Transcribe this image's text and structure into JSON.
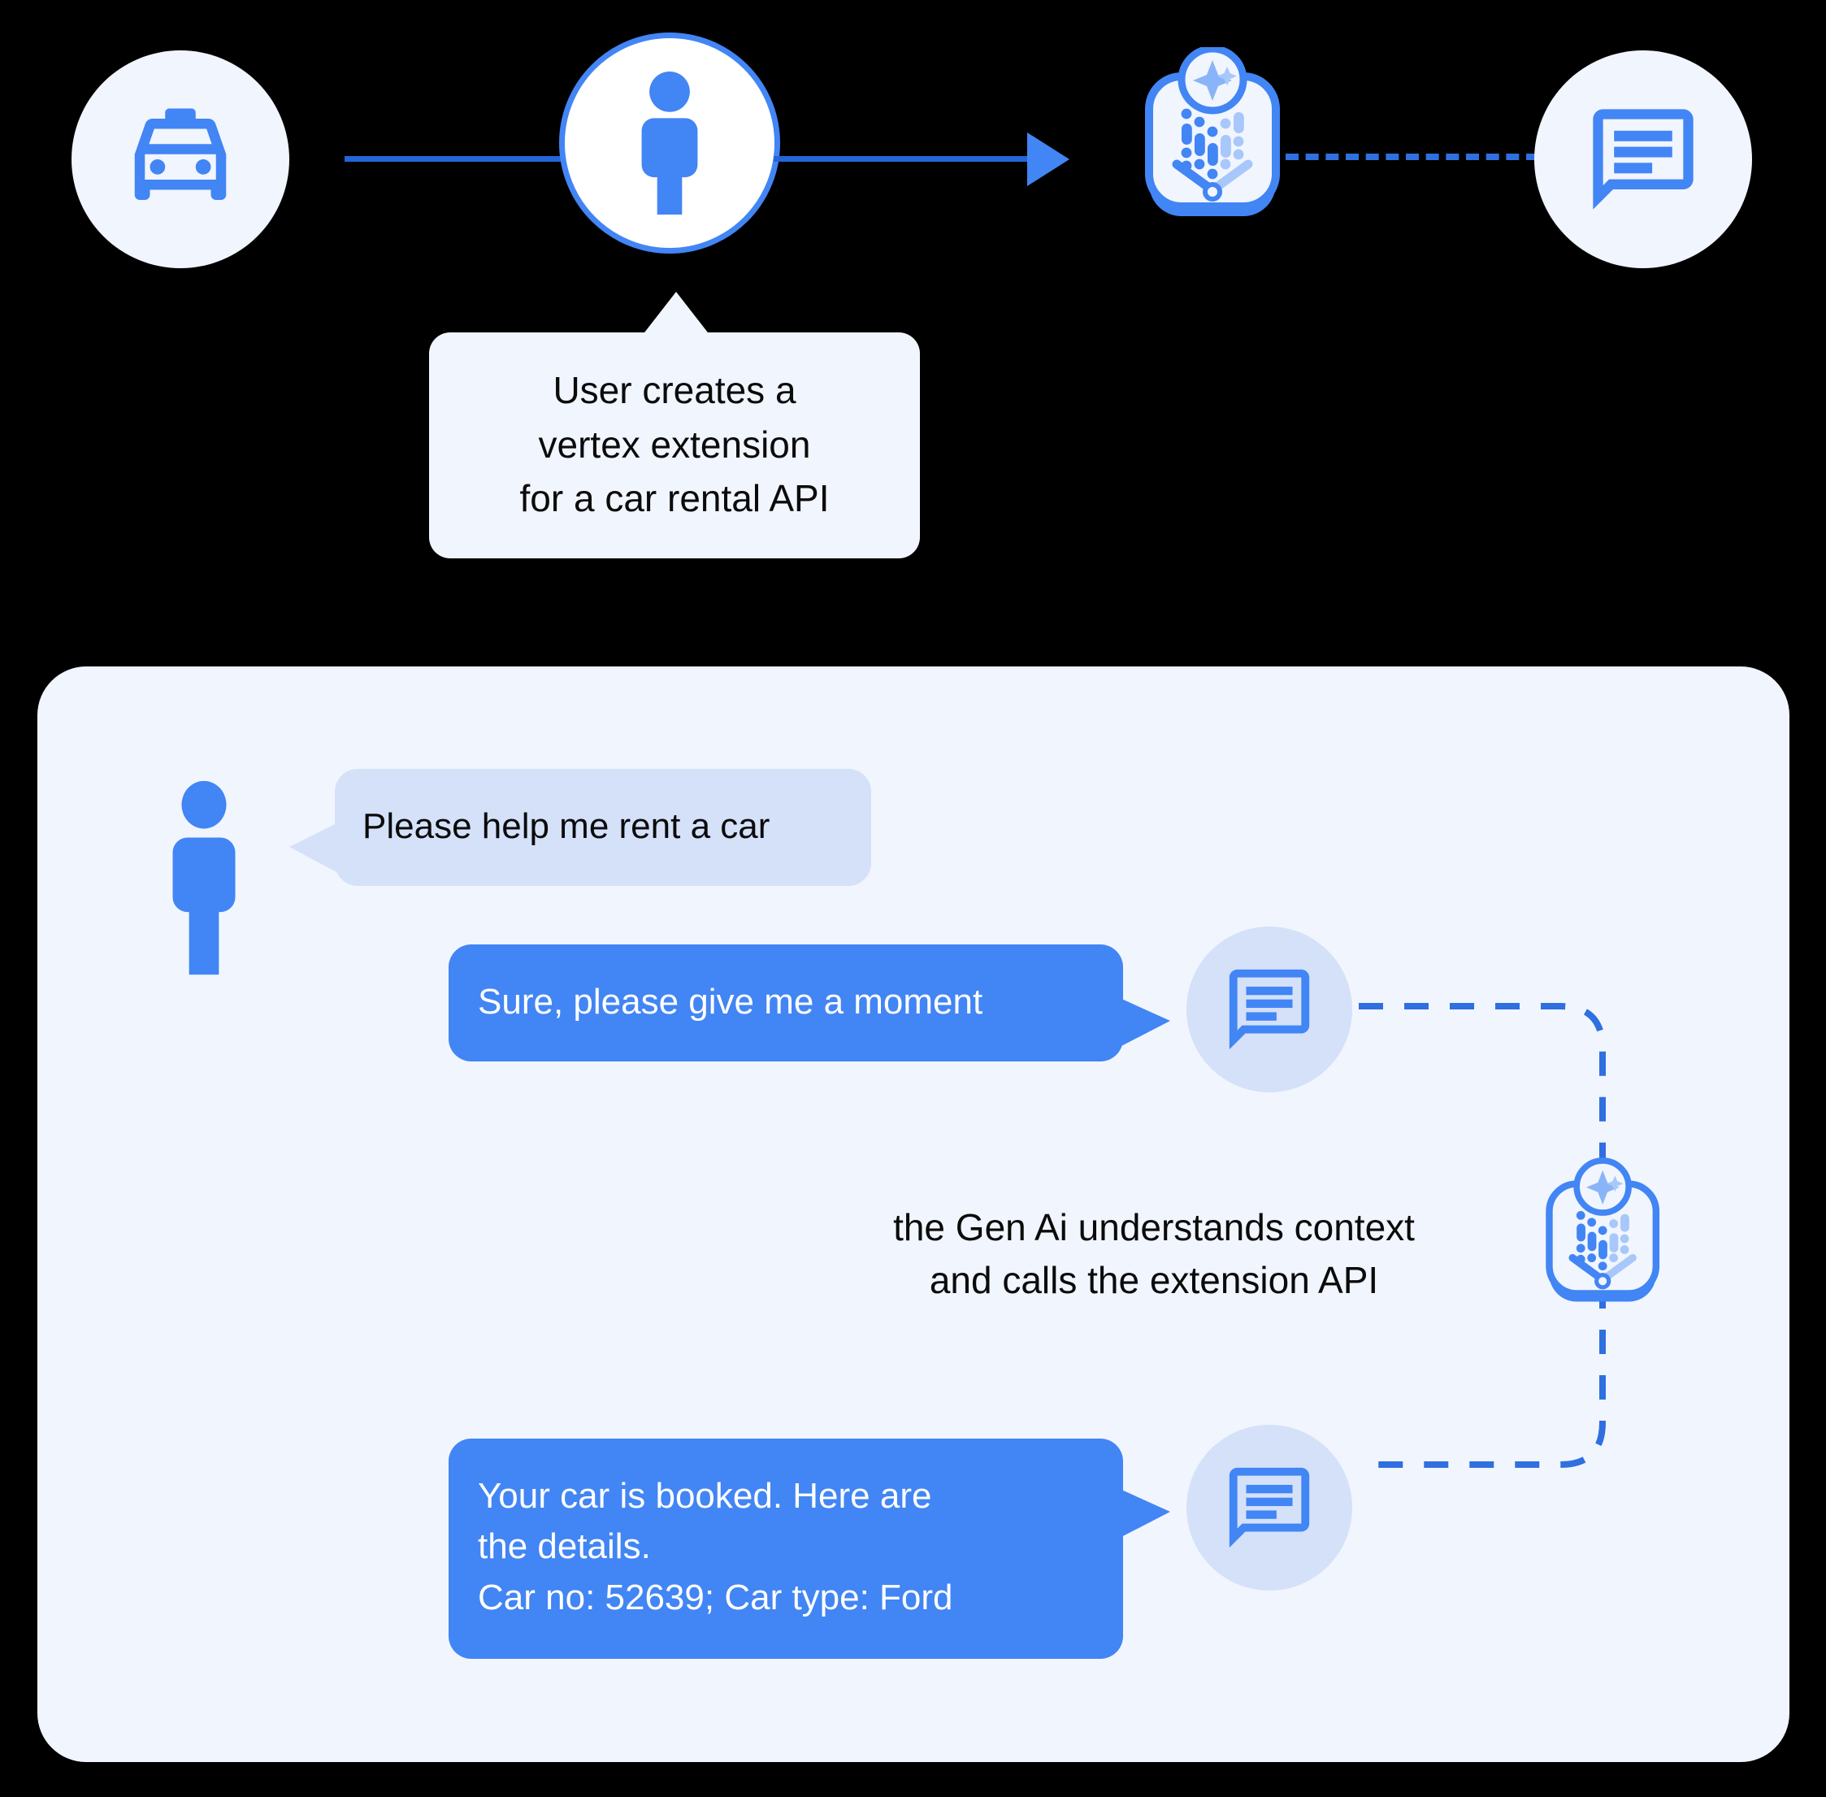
{
  "colors": {
    "background": "#000000",
    "panel_bg": "#f1f5fe",
    "accent_blue": "#4285f4",
    "line_blue": "#2465d8",
    "user_bubble": "#d4e1f9",
    "text_dark": "#0b0b0b",
    "text_light": "#ffffff"
  },
  "top_flow": {
    "nodes": [
      {
        "name": "taxi-icon",
        "label": "taxi-icon"
      },
      {
        "name": "user-icon",
        "label": "person-icon"
      },
      {
        "name": "vertex-extension-icon",
        "label": "vertex-extension-icon"
      },
      {
        "name": "chat-icon",
        "label": "chat-bubble-icon"
      }
    ],
    "tooltip": {
      "lines": [
        "User creates a",
        "vertex extension",
        "for a car rental API"
      ]
    }
  },
  "chat": {
    "messages": [
      {
        "role": "user",
        "text": "Please help me rent a car",
        "avatar": "person-icon"
      },
      {
        "role": "assistant",
        "text": "Sure, please give me a moment",
        "avatar": "chat-bubble-icon"
      },
      {
        "role": "assistant",
        "lines": [
          "Your car is booked. Here are",
          "the details.",
          "Car no: 52639; Car type: Ford"
        ],
        "avatar": "chat-bubble-icon"
      }
    ],
    "caption": {
      "lines": [
        "the Gen Ai understands context",
        "and calls the extension API"
      ]
    },
    "extension_icon": "vertex-extension-icon"
  }
}
